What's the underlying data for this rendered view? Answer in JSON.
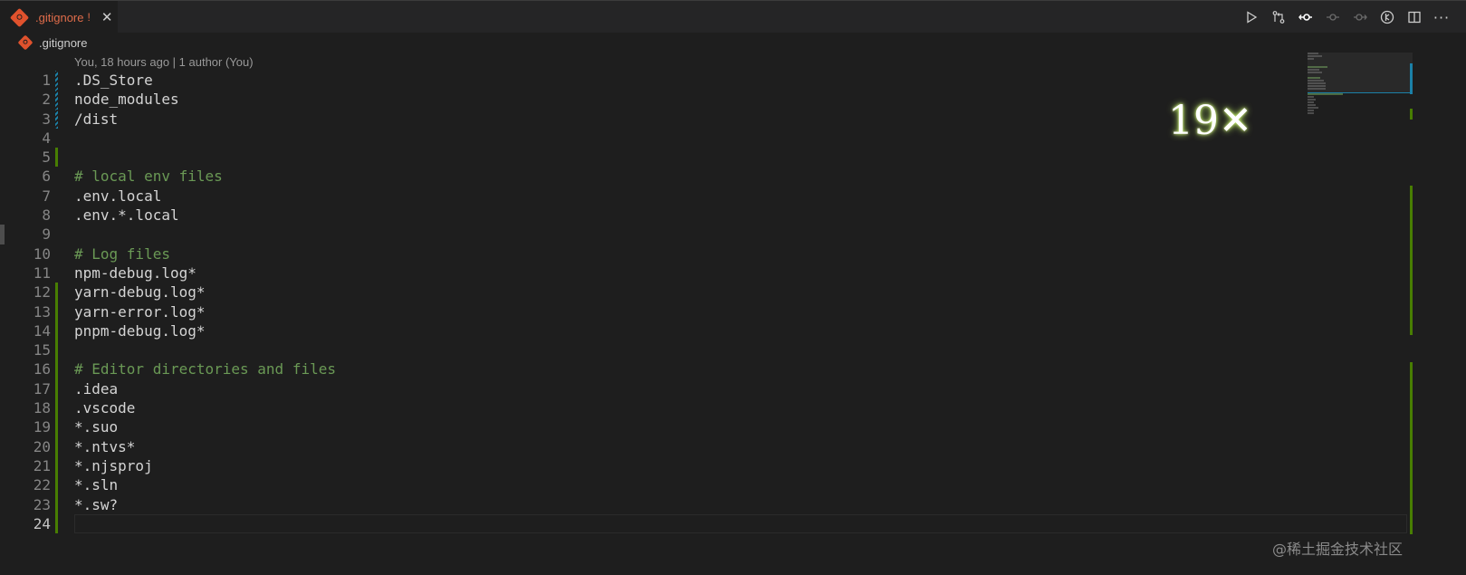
{
  "tab": {
    "label": ".gitignore",
    "modified_marker": "!",
    "close": "✕",
    "icon": "git-icon"
  },
  "toolbar": {
    "icons": [
      "run-icon",
      "open-changes-icon",
      "git-commit-icon",
      "previous-commit-icon",
      "next-commit-icon",
      "gitlens-icon",
      "split-editor-icon",
      "more-icon"
    ],
    "more_label": "···"
  },
  "breadcrumb": {
    "file": ".gitignore",
    "icon": "git-icon"
  },
  "codelens": "You, 18 hours ago | 1 author (You)",
  "editor": {
    "active_line": 24,
    "lines": [
      {
        "n": "1",
        "text": ".DS_Store",
        "type": "code",
        "gutter": "mod"
      },
      {
        "n": "2",
        "text": "node_modules",
        "type": "code",
        "gutter": "mod"
      },
      {
        "n": "3",
        "text": "/dist",
        "type": "code",
        "gutter": "mod"
      },
      {
        "n": "4",
        "text": "",
        "type": "code",
        "gutter": ""
      },
      {
        "n": "5",
        "text": "",
        "type": "code",
        "gutter": "add"
      },
      {
        "n": "6",
        "text": "# local env files",
        "type": "comment",
        "gutter": ""
      },
      {
        "n": "7",
        "text": ".env.local",
        "type": "code",
        "gutter": ""
      },
      {
        "n": "8",
        "text": ".env.*.local",
        "type": "code",
        "gutter": ""
      },
      {
        "n": "9",
        "text": "",
        "type": "code",
        "gutter": ""
      },
      {
        "n": "10",
        "text": "# Log files",
        "type": "comment",
        "gutter": ""
      },
      {
        "n": "11",
        "text": "npm-debug.log*",
        "type": "code",
        "gutter": ""
      },
      {
        "n": "12",
        "text": "yarn-debug.log*",
        "type": "code",
        "gutter": "add"
      },
      {
        "n": "13",
        "text": "yarn-error.log*",
        "type": "code",
        "gutter": "add"
      },
      {
        "n": "14",
        "text": "pnpm-debug.log*",
        "type": "code",
        "gutter": "add"
      },
      {
        "n": "15",
        "text": "",
        "type": "code",
        "gutter": "add"
      },
      {
        "n": "16",
        "text": "# Editor directories and files",
        "type": "comment",
        "gutter": "add"
      },
      {
        "n": "17",
        "text": ".idea",
        "type": "code",
        "gutter": "add"
      },
      {
        "n": "18",
        "text": ".vscode",
        "type": "code",
        "gutter": "add"
      },
      {
        "n": "19",
        "text": "*.suo",
        "type": "code",
        "gutter": "add"
      },
      {
        "n": "20",
        "text": "*.ntvs*",
        "type": "code",
        "gutter": "add"
      },
      {
        "n": "21",
        "text": "*.njsproj",
        "type": "code",
        "gutter": "add"
      },
      {
        "n": "22",
        "text": "*.sln",
        "type": "code",
        "gutter": "add"
      },
      {
        "n": "23",
        "text": "*.sw?",
        "type": "code",
        "gutter": "add"
      },
      {
        "n": "24",
        "text": "",
        "type": "code",
        "gutter": "add"
      }
    ]
  },
  "overlay_text": "19✕",
  "watermark": "@稀土掘金技术社区",
  "colors": {
    "gutter_modified": "#1b81a8",
    "gutter_added": "#487e02",
    "comment": "#6a9955",
    "tab_label": "#e06c4a"
  }
}
